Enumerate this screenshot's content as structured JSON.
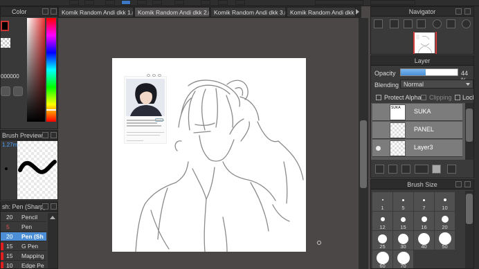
{
  "tabs": [
    {
      "label": "Komik Random Andi dkk 1.mdp",
      "active": false
    },
    {
      "label": "Komik Random Andi dkk 2.mdp",
      "active": true
    },
    {
      "label": "Komik Random Andi dkk 3.mdp",
      "active": false
    },
    {
      "label": "Komik Random Andi dkk 4.m",
      "active": false
    }
  ],
  "color_panel": {
    "title": "Color",
    "hex_value": "000000"
  },
  "brush_preview": {
    "title": "Brush Preview",
    "size_label": "1.27mr"
  },
  "tools": {
    "title": "sh: Pen (Sharp)",
    "items": [
      {
        "size": "20",
        "name": "Pencil",
        "swatch": "#3a3939",
        "selected": false
      },
      {
        "size": "5",
        "name": "Pen",
        "swatch": "#3a3939",
        "selected": false
      },
      {
        "size": "20",
        "name": "Pen (Sh",
        "swatch": "#3a3939",
        "selected": true
      },
      {
        "size": "15",
        "name": "G Pen",
        "swatch": "#e02020",
        "selected": false
      },
      {
        "size": "15",
        "name": "Mapping",
        "swatch": "#e02020",
        "selected": false
      },
      {
        "size": "10",
        "name": "Edge Pe",
        "swatch": "#e02020",
        "selected": false
      }
    ]
  },
  "navigator": {
    "title": "Navigator"
  },
  "layer_panel": {
    "title": "Layer",
    "opacity_label": "Opacity",
    "opacity_value": "44 %",
    "opacity_fraction": 0.44,
    "blending_label": "Blending",
    "blending_value": "Normal",
    "protect_alpha": "Protect Alpha",
    "clipping": "Clipping",
    "lock": "Lock",
    "layers": [
      {
        "name": "SUKA",
        "visible": false,
        "thumb_text": "SUKA"
      },
      {
        "name": "PANEL",
        "visible": false,
        "thumb_text": ""
      },
      {
        "name": "Layer3",
        "visible": true,
        "thumb_text": ""
      }
    ]
  },
  "brush_size": {
    "title": "Brush Size",
    "rows": [
      [
        "1",
        "5",
        "7",
        "10"
      ],
      [
        "12",
        "15",
        "16",
        "20"
      ],
      [
        "25",
        "30",
        "40",
        "50"
      ],
      [
        "60",
        "70",
        "",
        ""
      ]
    ]
  },
  "reference_post": {
    "title_text": "Kiri ucchi Fan Art",
    "caption": "Shared image"
  }
}
